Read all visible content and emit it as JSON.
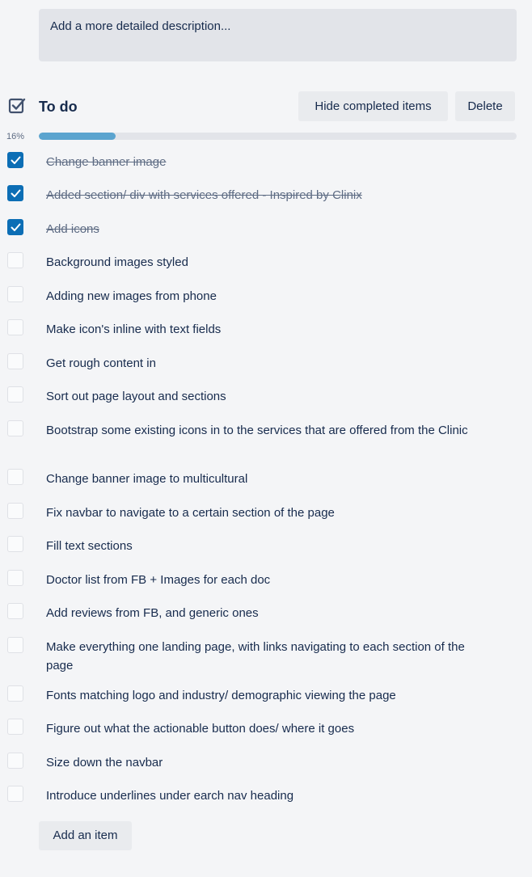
{
  "description": {
    "placeholder": "Add a more detailed description..."
  },
  "checklist": {
    "title": "To do",
    "hide_completed_label": "Hide completed items",
    "delete_label": "Delete",
    "progress_label": "16%",
    "progress_fraction": 0.16,
    "accent_color": "#0c6eb5",
    "progress_color": "#5ba4cf",
    "items": [
      {
        "label": "Change banner image",
        "checked": true
      },
      {
        "label": "Added section/ div with services offered - Inspired by Clinix",
        "checked": true
      },
      {
        "label": "Add icons",
        "checked": true
      },
      {
        "label": "Background images styled",
        "checked": false
      },
      {
        "label": "Adding new images from phone",
        "checked": false
      },
      {
        "label": "Make icon's inline with text fields",
        "checked": false
      },
      {
        "label": "Get rough content in",
        "checked": false
      },
      {
        "label": "Sort out page layout and sections",
        "checked": false
      },
      {
        "label": "Bootstrap some existing icons in to the services that are offered from the Clinic",
        "checked": false
      },
      {
        "label": "Change banner image to multicultural",
        "checked": false
      },
      {
        "label": "Fix navbar to navigate to a certain section of the page",
        "checked": false
      },
      {
        "label": "Fill text sections",
        "checked": false
      },
      {
        "label": "Doctor list from FB + Images for each doc",
        "checked": false
      },
      {
        "label": "Add reviews from FB, and generic ones",
        "checked": false
      },
      {
        "label": "Make everything one landing page, with links navigating to each section of the page",
        "checked": false
      },
      {
        "label": "Fonts matching logo and industry/ demographic viewing the page",
        "checked": false
      },
      {
        "label": "Figure out what the actionable button does/ where it goes",
        "checked": false
      },
      {
        "label": "Size down the navbar",
        "checked": false
      },
      {
        "label": "Introduce underlines under earch nav heading",
        "checked": false
      }
    ],
    "add_item_label": "Add an item"
  }
}
